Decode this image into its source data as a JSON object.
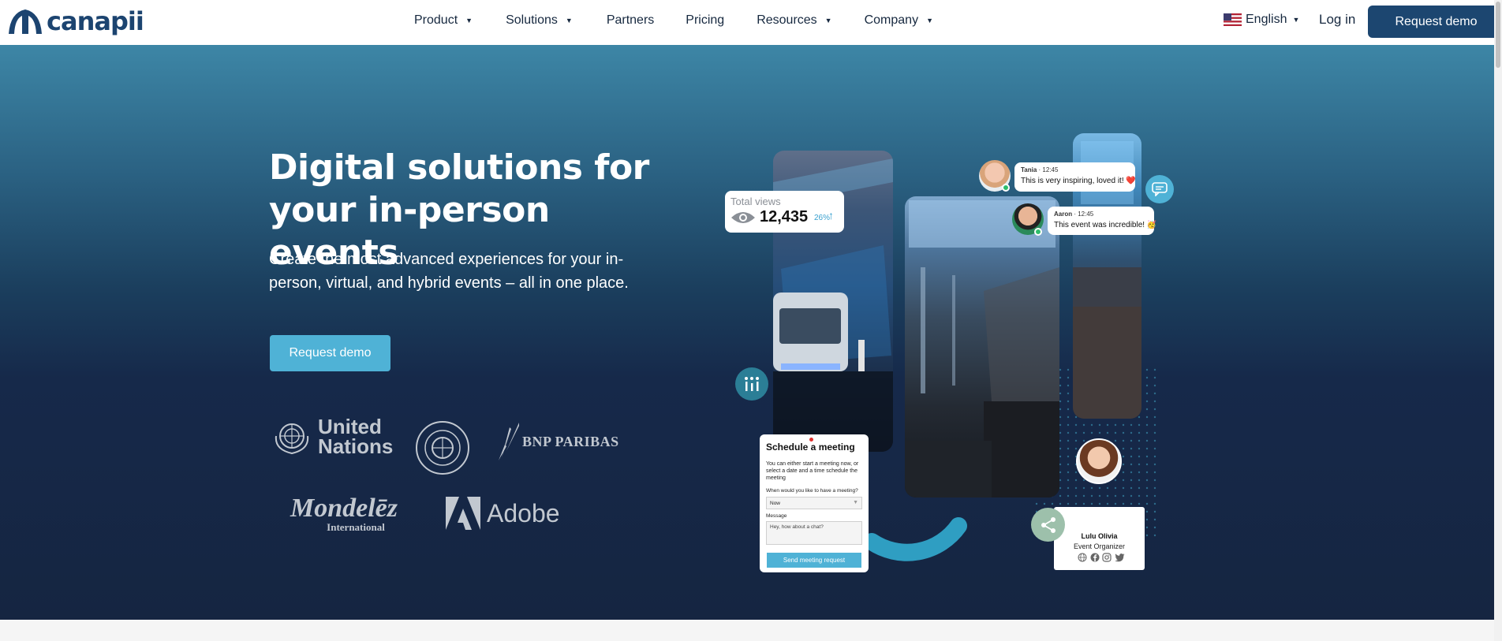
{
  "brand": {
    "name": "canapii",
    "color": "#1c4470"
  },
  "nav": {
    "items": [
      {
        "label": "Product",
        "has_dropdown": true
      },
      {
        "label": "Solutions",
        "has_dropdown": true
      },
      {
        "label": "Partners",
        "has_dropdown": false
      },
      {
        "label": "Pricing",
        "has_dropdown": false
      },
      {
        "label": "Resources",
        "has_dropdown": true
      },
      {
        "label": "Company",
        "has_dropdown": true
      }
    ],
    "language": "English",
    "login": "Log in",
    "cta": "Request demo"
  },
  "hero": {
    "headline": "Digital solutions for your in-person events",
    "subheadline": "Create the most advanced experiences for your in-person, virtual, and hybrid events – all in one place.",
    "cta": "Request demo",
    "clients": [
      {
        "name": "United Nations",
        "lines": [
          "United",
          "Nations"
        ]
      },
      {
        "name": "International Monetary Fund",
        "lines": []
      },
      {
        "name": "BNP PARIBAS",
        "lines": [
          "BNP PARIBAS"
        ]
      },
      {
        "name": "Mondelēz International",
        "lines": [
          "Mondelēz",
          "International"
        ]
      },
      {
        "name": "Adobe",
        "lines": [
          "Adobe"
        ]
      }
    ]
  },
  "visual": {
    "stat": {
      "label": "Total views",
      "value": "12,435",
      "change": "26%"
    },
    "chat": [
      {
        "name": "Tania",
        "time": "12:45",
        "message": "This is very inspiring, loved it! ❤️"
      },
      {
        "name": "Aaron",
        "time": "12:45",
        "message": "This event was incredible! 🥳"
      }
    ],
    "meeting": {
      "title": "Schedule a meeting",
      "description": "You can either start a meeting now, or select a date and a time schedule the meeting",
      "question": "When would you like to have a meeting?",
      "selected": "Now",
      "message_label": "Message",
      "message_value": "Hey, how about a chat?",
      "send": "Send meeting request"
    },
    "profile": {
      "name": "Lulu Olivia",
      "role": "Event Organizer"
    },
    "colors": {
      "accent": "#4fb2d6",
      "teal_icon": "#2b7e96",
      "sage_icon": "#9dc0ab",
      "arc": "#2f9ec2"
    }
  },
  "icons": {
    "eye": "eye-icon",
    "chat": "chat-bubbles-icon",
    "poll": "poll-icon",
    "share": "share-icon",
    "globe": "globe-icon",
    "facebook": "facebook-icon",
    "instagram": "instagram-icon",
    "twitter": "twitter-icon"
  }
}
